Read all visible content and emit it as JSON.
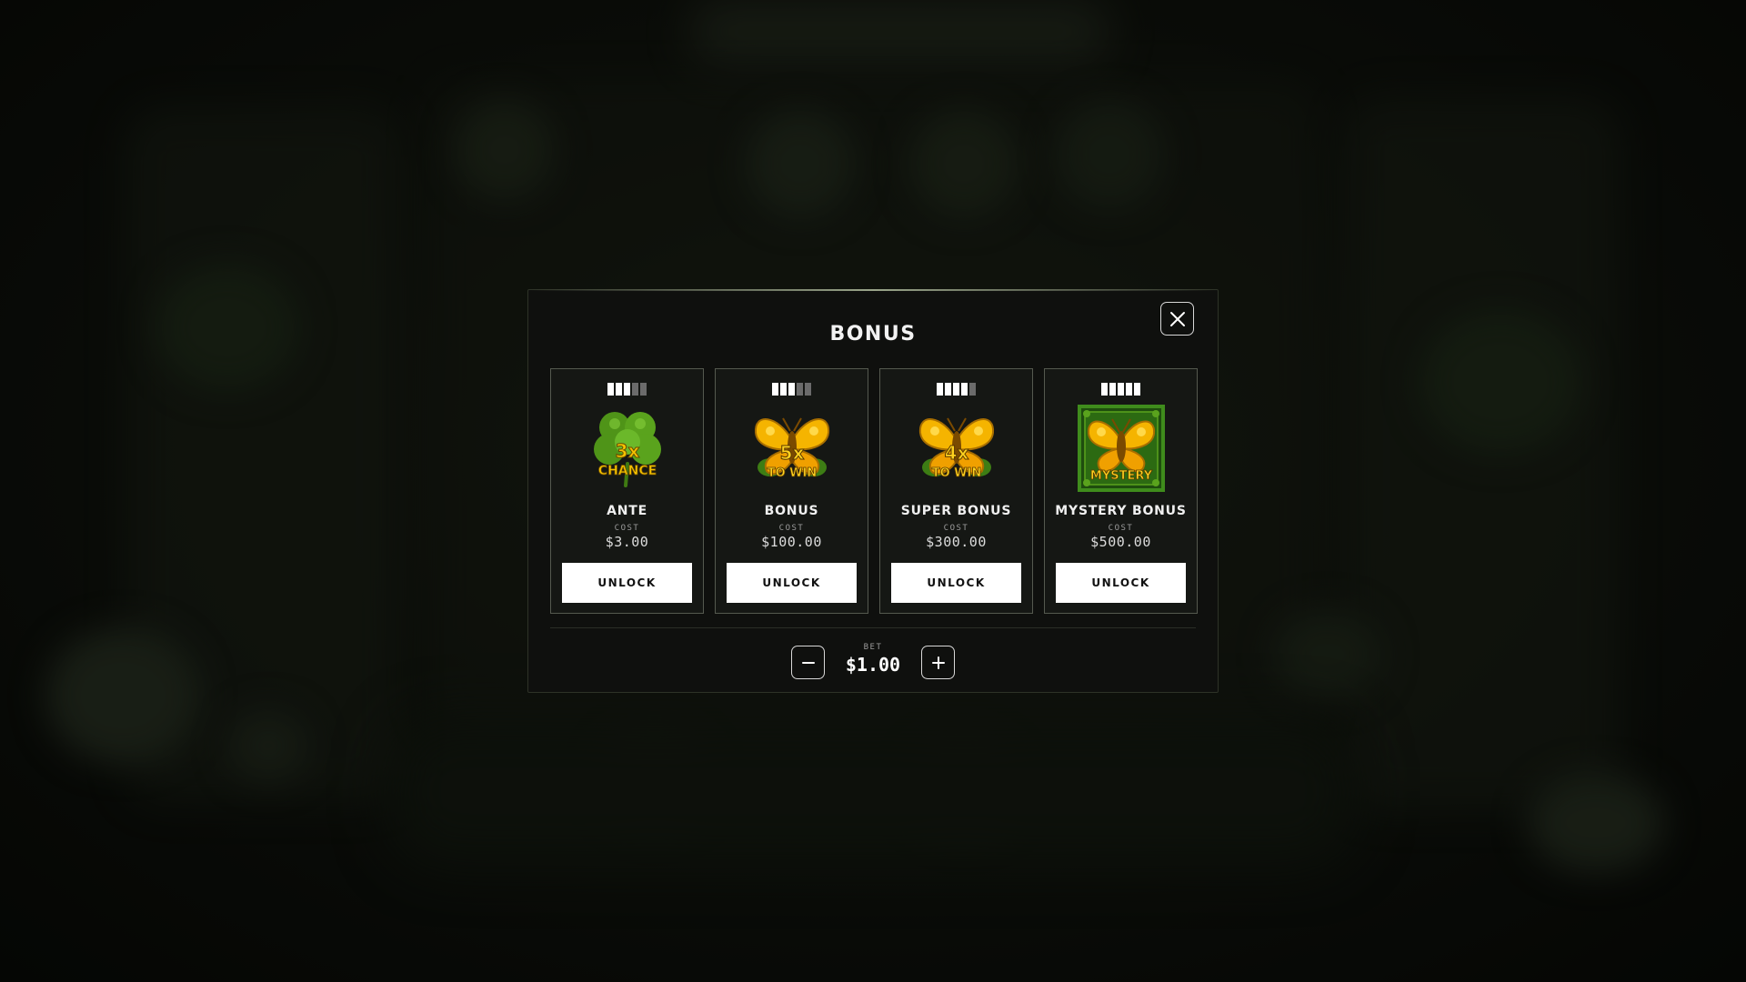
{
  "modal": {
    "title": "BONUS",
    "close_icon": "close-icon"
  },
  "cards": [
    {
      "name": "ANTE",
      "cost_label": "COST",
      "cost": "$3.00",
      "button": "UNLOCK",
      "volatility": 3,
      "volatility_max": 5,
      "icon": "clover-icon",
      "icon_text_top": "3x",
      "icon_text_bottom": "CHANCE"
    },
    {
      "name": "BONUS",
      "cost_label": "COST",
      "cost": "$100.00",
      "button": "UNLOCK",
      "volatility": 3,
      "volatility_max": 5,
      "icon": "butterfly-icon",
      "icon_text_top": "5x",
      "icon_text_bottom": "TO WIN"
    },
    {
      "name": "SUPER BONUS",
      "cost_label": "COST",
      "cost": "$300.00",
      "button": "UNLOCK",
      "volatility": 4,
      "volatility_max": 5,
      "icon": "butterfly-icon",
      "icon_text_top": "4x",
      "icon_text_bottom": "TO WIN"
    },
    {
      "name": "MYSTERY BONUS",
      "cost_label": "COST",
      "cost": "$500.00",
      "button": "UNLOCK",
      "volatility": 5,
      "volatility_max": 5,
      "icon": "mystery-butterfly-icon",
      "icon_text_top": "",
      "icon_text_bottom": "MYSTERY"
    }
  ],
  "bet": {
    "label": "BET",
    "value": "$1.00",
    "minus_icon": "minus-icon",
    "plus_icon": "plus-icon"
  },
  "colors": {
    "accent_gold": "#f5b400",
    "clover_green": "#5c9e1e",
    "frame_green": "#3f8c1c",
    "button_bg": "#ffffff"
  }
}
